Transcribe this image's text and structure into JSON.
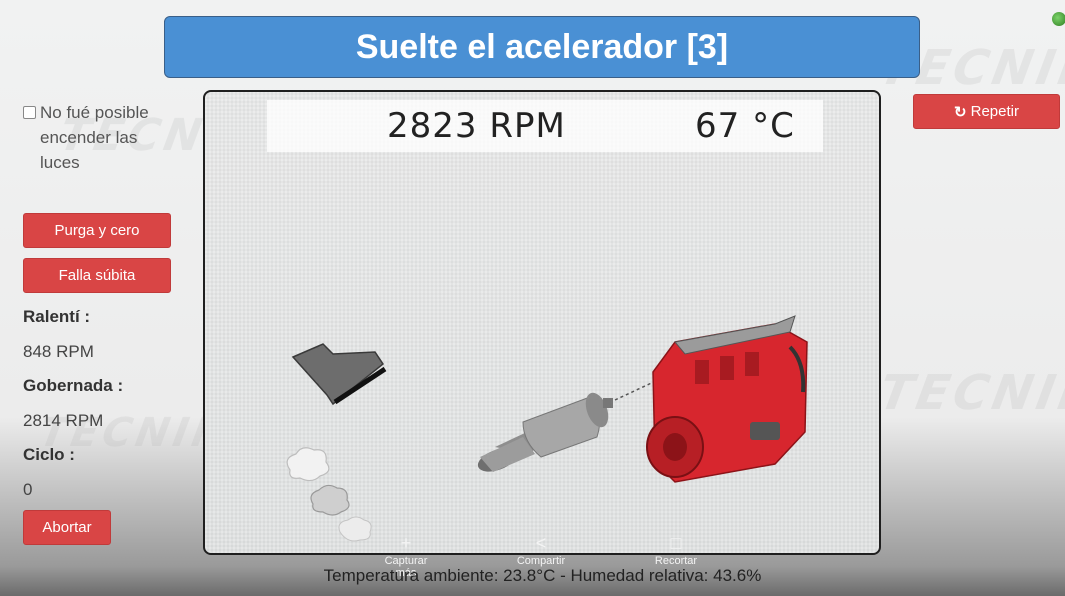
{
  "header": {
    "title": "Suelte el acelerador [3]"
  },
  "sidebar": {
    "checkbox_label": "No fué posible encender las luces",
    "purga_label": "Purga y cero",
    "falla_label": "Falla súbita",
    "ralenti_label": "Ralentí :",
    "ralenti_value": "848 RPM",
    "gobernada_label": "Gobernada :",
    "gobernada_value": "2814 RPM",
    "ciclo_label": "Ciclo :",
    "ciclo_value": "0",
    "abortar_label": "Abortar"
  },
  "actions": {
    "repetir_label": "Repetir"
  },
  "readout": {
    "rpm": "2823 RPM",
    "temp": "67 °C"
  },
  "footer": {
    "text": "Temperatura ambiente: 23.8°C - Humedad relativa: 43.6%"
  },
  "toolbar": {
    "capture_label": "Capturar más",
    "share_label": "Compartir",
    "crop_label": "Recortar"
  },
  "watermark": {
    "text": "TECNIMAQ"
  },
  "colors": {
    "title_bg": "#4a90d4",
    "button_red": "#d94545",
    "engine_red": "#d7262e"
  },
  "icons": [
    "refresh-icon",
    "pedal-icon",
    "exhaust-icon",
    "engine-icon",
    "smoke-icon",
    "plus-icon",
    "share-icon",
    "crop-icon"
  ]
}
